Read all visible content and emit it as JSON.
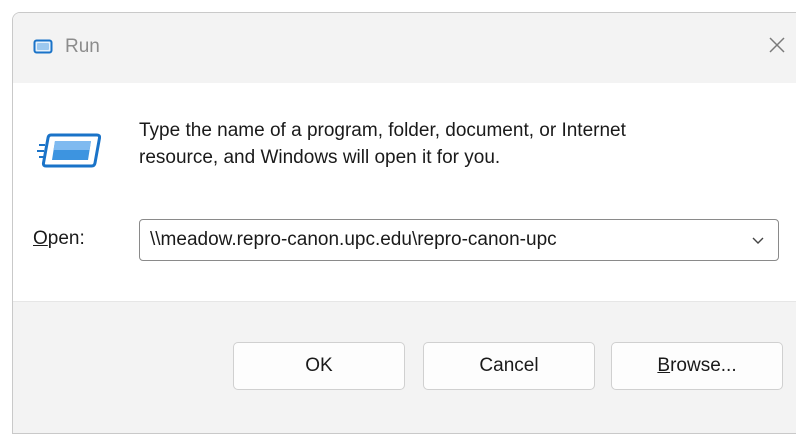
{
  "window": {
    "title": "Run",
    "title_icon": "run-dialog-icon",
    "close_icon": "close-icon"
  },
  "content": {
    "description_line1": "Type the name of a program, folder, document, or Internet",
    "description_line2": "resource, and Windows will open it for you.",
    "open_label_mnemonic": "O",
    "open_label_rest": "pen:",
    "open_value": "\\\\meadow.repro-canon.upc.edu\\repro-canon-upc",
    "dropdown_icon": "chevron-down-icon"
  },
  "buttons": {
    "ok": "OK",
    "cancel": "Cancel",
    "browse_mnemonic": "B",
    "browse_rest": "rowse..."
  },
  "colors": {
    "accent": "#0067c0",
    "titlebar_bg": "#f3f3f3",
    "footer_bg": "#f3f3f3"
  }
}
